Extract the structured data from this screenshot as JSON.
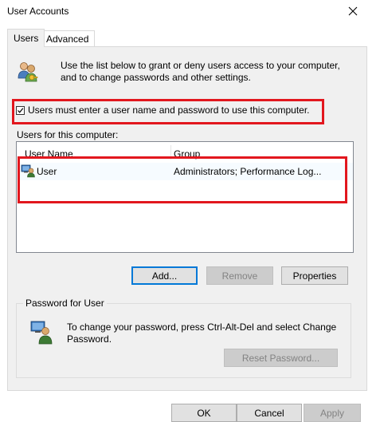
{
  "window": {
    "title": "User Accounts"
  },
  "tabs": [
    {
      "label": "Users",
      "active": true
    },
    {
      "label": "Advanced",
      "active": false
    }
  ],
  "intro": {
    "text": "Use the list below to grant or deny users access to your computer, and to change passwords and other settings."
  },
  "require_login": {
    "label": "Users must enter a user name and password to use this computer.",
    "checked": true
  },
  "users_list": {
    "label": "Users for this computer:",
    "columns": [
      "User Name",
      "Group"
    ],
    "rows": [
      {
        "name": "User",
        "group": "Administrators; Performance Log..."
      }
    ]
  },
  "list_buttons": {
    "add": "Add...",
    "remove": "Remove",
    "properties": "Properties"
  },
  "password_group": {
    "legend": "Password for User",
    "text": "To change your password, press Ctrl-Alt-Del and select Change Password.",
    "reset_button": "Reset Password..."
  },
  "dialog_buttons": {
    "ok": "OK",
    "cancel": "Cancel",
    "apply": "Apply"
  },
  "colors": {
    "highlight_box": "#e2171e",
    "focus_border": "#0078d7",
    "panel_bg": "#f0f0f0"
  }
}
